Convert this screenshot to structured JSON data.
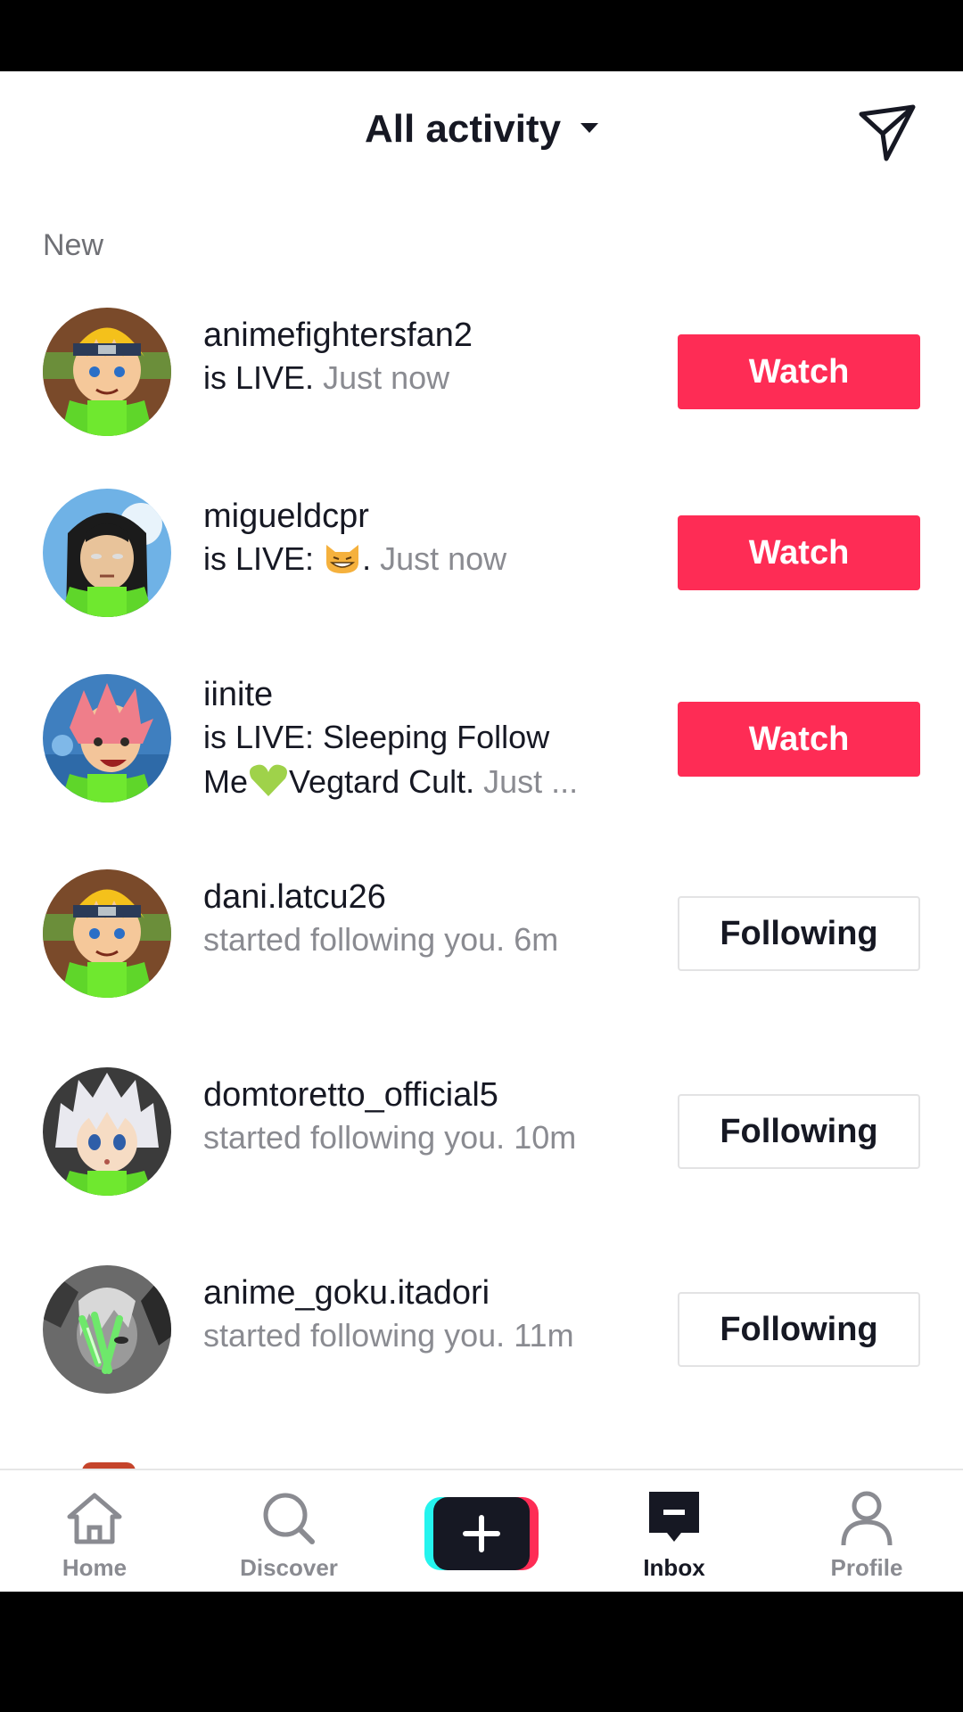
{
  "header": {
    "title": "All activity"
  },
  "section": {
    "label": "New"
  },
  "rows": [
    {
      "username": "animefightersfan2",
      "desc_main": "is LIVE.",
      "desc_time": "Just now",
      "button": "Watch",
      "avatar": "naruto-avatar"
    },
    {
      "username": "migueldcpr",
      "desc_main": "is LIVE:",
      "desc_after_emoji": ".",
      "desc_time": "Just now",
      "emoji": "grinning-cat-emoji",
      "button": "Watch",
      "avatar": "neji-avatar"
    },
    {
      "username": "iinite",
      "desc_line1": "is LIVE: Sleeping Follow",
      "desc_line2a": "Me",
      "emoji": "green-heart-emoji",
      "desc_line2b": "Vegtard Cult.",
      "desc_time": "Just ...",
      "button": "Watch",
      "avatar": "natsu-avatar"
    },
    {
      "username": "dani.latcu26",
      "desc_main": "started following you.",
      "desc_time": "6m",
      "button": "Following",
      "avatar": "naruto-avatar"
    },
    {
      "username": "domtoretto_official5",
      "desc_main": "started following you.",
      "desc_time": "10m",
      "button": "Following",
      "avatar": "killua-avatar"
    },
    {
      "username": "anime_goku.itadori",
      "desc_main": "started following you.",
      "desc_time": "11m",
      "button": "Following",
      "avatar": "green-face-avatar"
    }
  ],
  "nav": {
    "home": "Home",
    "discover": "Discover",
    "inbox": "Inbox",
    "profile": "Profile"
  },
  "colors": {
    "accent": "#fe2c55",
    "text": "#161823",
    "muted": "#8a8b91"
  }
}
